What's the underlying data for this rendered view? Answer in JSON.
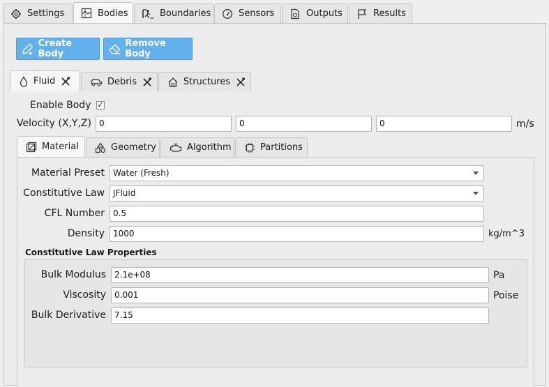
{
  "top_tabs": [
    {
      "label": "Settings",
      "icon": "gear-icon"
    },
    {
      "label": "Bodies",
      "icon": "bodies-icon"
    },
    {
      "label": "Boundaries",
      "icon": "boundaries-icon"
    },
    {
      "label": "Sensors",
      "icon": "sensor-icon"
    },
    {
      "label": "Outputs",
      "icon": "outputs-icon"
    },
    {
      "label": "Results",
      "icon": "flag-icon"
    }
  ],
  "actions": {
    "create_body": "Create Body",
    "remove_body": "Remove Body"
  },
  "body_tabs": [
    {
      "label": "Fluid",
      "icon": "droplet-icon"
    },
    {
      "label": "Debris",
      "icon": "car-icon"
    },
    {
      "label": "Structures",
      "icon": "house-icon"
    }
  ],
  "body": {
    "enable_label": "Enable Body",
    "enable_checked": "✓",
    "velocity_label": "Velocity (X,Y,Z)",
    "velocity": [
      "0",
      "0",
      "0"
    ],
    "velocity_unit": "m/s"
  },
  "sub_tabs": [
    {
      "label": "Material",
      "icon": "material-icon"
    },
    {
      "label": "Geometry",
      "icon": "geometry-icon"
    },
    {
      "label": "Algorithm",
      "icon": "engine-icon"
    },
    {
      "label": "Partitions",
      "icon": "chip-icon"
    }
  ],
  "material": {
    "preset_label": "Material Preset",
    "preset_value": "Water (Fresh)",
    "law_label": "Constitutive Law",
    "law_value": "JFluid",
    "cfl_label": "CFL Number",
    "cfl_value": "0.5",
    "density_label": "Density",
    "density_value": "1000",
    "density_unit": "kg/m^3"
  },
  "law_props": {
    "heading": "Constitutive Law Properties",
    "bulk_modulus_label": "Bulk Modulus",
    "bulk_modulus_value": "2.1e+08",
    "bulk_modulus_unit": "Pa",
    "viscosity_label": "Viscosity",
    "viscosity_value": "0.001",
    "viscosity_unit": "Poise",
    "bulk_derivative_label": "Bulk Derivative",
    "bulk_derivative_value": "7.15"
  }
}
